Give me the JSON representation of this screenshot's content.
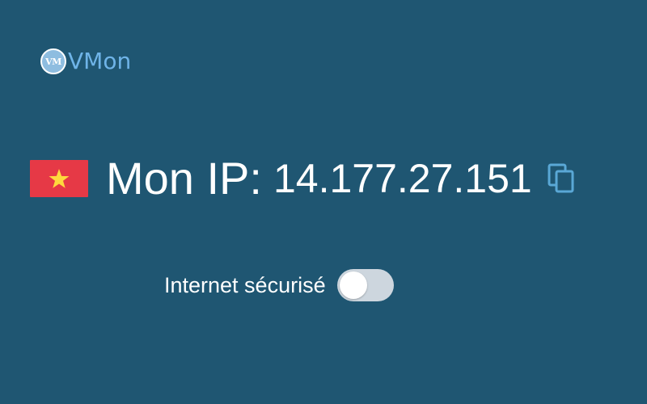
{
  "app": {
    "logo_badge": "VM",
    "logo_text": "VMon"
  },
  "ip_panel": {
    "flag_icon": "vietnam-flag-icon",
    "label": "Mon IP:",
    "ip_address": "14.177.27.151",
    "copy_icon": "copy-icon"
  },
  "secure": {
    "label": "Internet sécurisé",
    "enabled": false
  },
  "colors": {
    "background": "#1f5672",
    "logo_text": "#6fb4e8",
    "flag_red": "#e63946",
    "flag_star": "#ffd93d",
    "copy_icon": "#5aa8d6",
    "toggle_track_off": "#cdd6de"
  }
}
